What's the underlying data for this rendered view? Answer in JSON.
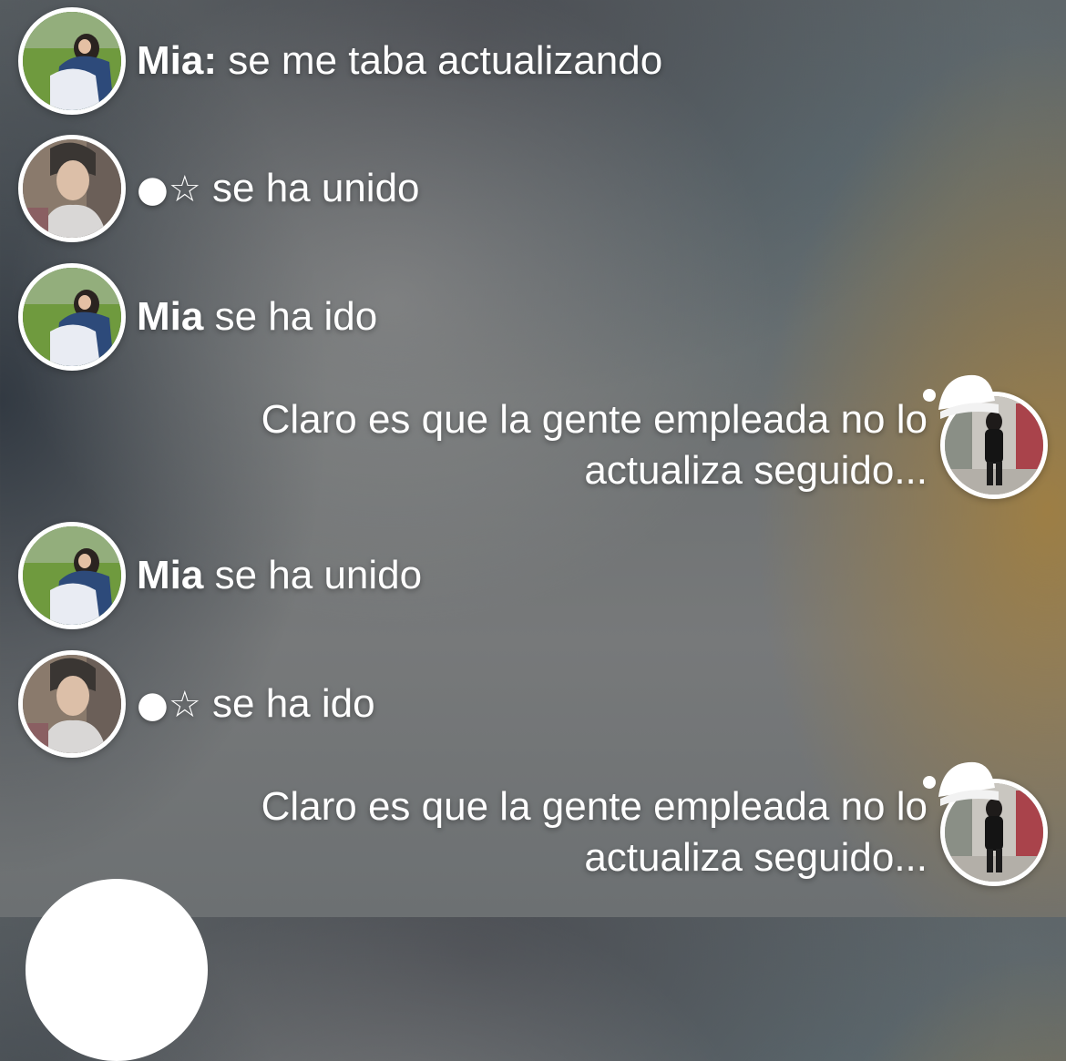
{
  "feed": [
    {
      "type": "message",
      "user": "Mia:",
      "text": "se me taba actualizando",
      "avatar": "mia-avatar"
    },
    {
      "type": "event",
      "user": "●☆",
      "text": "se ha unido",
      "avatar": "boy-avatar"
    },
    {
      "type": "event",
      "user": "Mia",
      "text": "se ha ido",
      "avatar": "mia-avatar"
    },
    {
      "type": "own-message",
      "text": "Claro es que la gente empleada no lo actualiza seguido...",
      "avatar": "store-avatar",
      "decoration": "santa-hat-icon"
    },
    {
      "type": "event",
      "user": "Mia",
      "text": "se ha unido",
      "avatar": "mia-avatar"
    },
    {
      "type": "event",
      "user": "●☆",
      "text": "se ha ido",
      "avatar": "boy-avatar"
    },
    {
      "type": "own-message",
      "text": "Claro es que la gente empleada no lo actualiza seguido...",
      "avatar": "store-avatar",
      "decoration": "santa-hat-icon"
    }
  ],
  "colors": {
    "text": "#ffffff",
    "avatar_border": "#ffffff",
    "warm_glow": "#a5803c"
  }
}
